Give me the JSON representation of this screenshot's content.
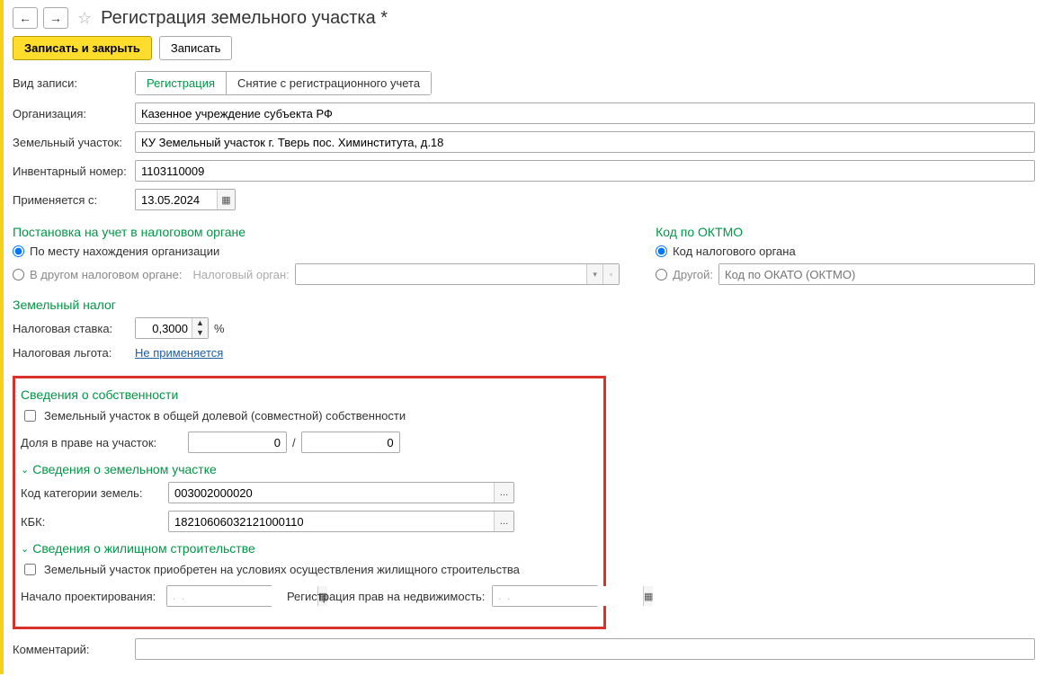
{
  "header": {
    "title": "Регистрация земельного участка *"
  },
  "toolbar": {
    "save_close": "Записать и закрыть",
    "save": "Записать"
  },
  "form": {
    "record_type_label": "Вид записи:",
    "record_type_opt1": "Регистрация",
    "record_type_opt2": "Снятие с регистрационного учета",
    "org_label": "Организация:",
    "org_value": "Казенное учреждение субъекта РФ",
    "plot_label": "Земельный участок:",
    "plot_value": "КУ Земельный участок г. Тверь пос. Химинститута, д.18",
    "inv_label": "Инвентарный номер:",
    "inv_value": "1103110009",
    "applies_label": "Применяется с:",
    "applies_date": "13.05.2024"
  },
  "tax_reg": {
    "title": "Постановка на учет в налоговом органе",
    "opt1": "По месту нахождения организации",
    "opt2": "В другом налоговом органе:",
    "tax_org_placeholder": "Налоговый орган:"
  },
  "oktmo": {
    "title": "Код по ОКТМО",
    "opt1": "Код налогового органа",
    "opt2": "Другой:",
    "okato_placeholder": "Код по ОКАТО (ОКТМО)"
  },
  "land_tax": {
    "title": "Земельный налог",
    "rate_label": "Налоговая ставка:",
    "rate_value": "0,3000",
    "pct": "%",
    "benefit_label": "Налоговая льгота:",
    "benefit_link": "Не применяется"
  },
  "ownership": {
    "title": "Сведения о собственности",
    "shared_label": "Земельный участок в общей долевой (совместной) собственности",
    "share_label": "Доля в праве на участок:",
    "share_num": "0",
    "share_sep": "/",
    "share_den": "0"
  },
  "plot_info": {
    "title": "Сведения о земельном участке",
    "cat_label": "Код категории земель:",
    "cat_value": "003002000020",
    "kbk_label": "КБК:",
    "kbk_value": "18210606032121000110"
  },
  "housing": {
    "title": "Сведения о жилищном строительстве",
    "acquired_label": "Земельный участок приобретен на условиях осуществления жилищного строительства",
    "design_start_label": "Начало проектирования:",
    "date_mask": ".  .",
    "rights_reg_label": "Регистрация прав на недвижимость:"
  },
  "comment": {
    "label": "Комментарий:"
  }
}
